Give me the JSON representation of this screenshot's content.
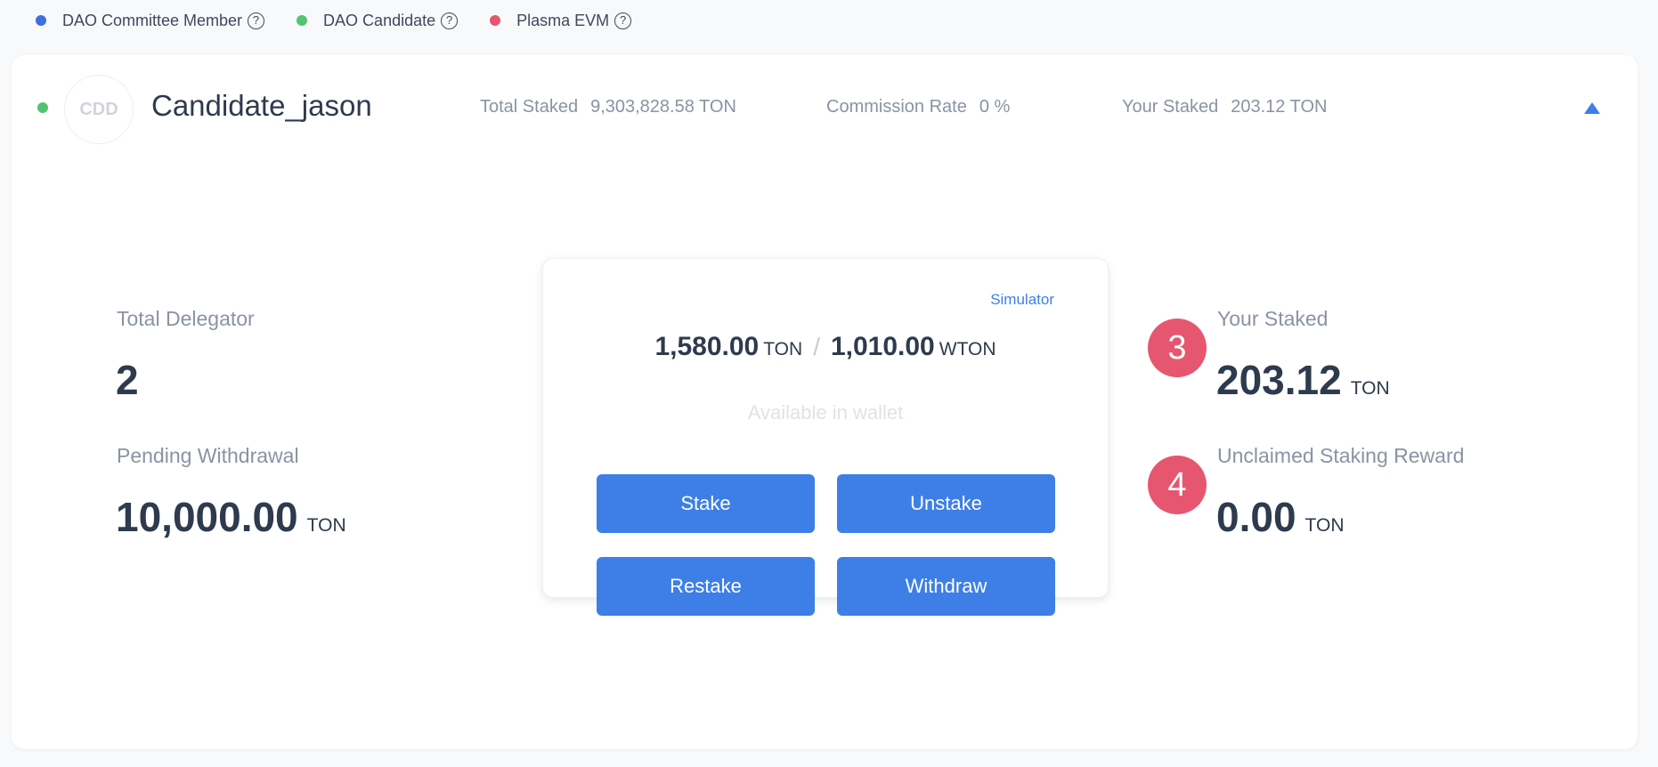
{
  "legend": [
    {
      "label": "DAO Committee Member",
      "color": "#3d6fe0",
      "icon": "help-circle-icon",
      "icon_glyph": "?"
    },
    {
      "label": "DAO Candidate",
      "color": "#52c370",
      "icon": "help-circle-icon",
      "icon_glyph": "?"
    },
    {
      "label": "Plasma EVM",
      "color": "#e6566f",
      "icon": "help-circle-icon",
      "icon_glyph": "?"
    }
  ],
  "candidate": {
    "status_color": "#52c370",
    "avatar_text": "CDD",
    "name": "Candidate_jason",
    "total_staked_label": "Total Staked",
    "total_staked_value": "9,303,828.58 TON",
    "commission_label": "Commission Rate",
    "commission_value": "0 %",
    "your_staked_label": "Your Staked",
    "your_staked_value": "203.12 TON",
    "collapse_icon": "chevron-up-icon"
  },
  "metrics": {
    "total_delegator_label": "Total Delegator",
    "total_delegator_value": "2",
    "pending_withdrawal_label": "Pending Withdrawal",
    "pending_withdrawal_value": "10,000.00",
    "pending_withdrawal_unit": "TON",
    "your_staked_label": "Your Staked",
    "your_staked_value": "203.12",
    "your_staked_unit": "TON",
    "unclaimed_label": "Unclaimed Staking Reward",
    "unclaimed_value": "0.00",
    "unclaimed_unit": "TON"
  },
  "wallet_panel": {
    "simulator_link": "Simulator",
    "ton_amount": "1,580.00",
    "ton_unit": "TON",
    "separator": "/",
    "wton_amount": "1,010.00",
    "wton_unit": "WTON",
    "available_text": "Available in wallet",
    "buttons": {
      "stake": "Stake",
      "unstake": "Unstake",
      "restake": "Restake",
      "withdraw": "Withdraw"
    }
  },
  "annotations": {
    "badge_3": "3",
    "badge_4": "4",
    "color": "#e6566f"
  },
  "colors": {
    "accent": "#3d7fe6",
    "text_primary": "#2e3a4d",
    "text_muted": "#8a93a3"
  }
}
